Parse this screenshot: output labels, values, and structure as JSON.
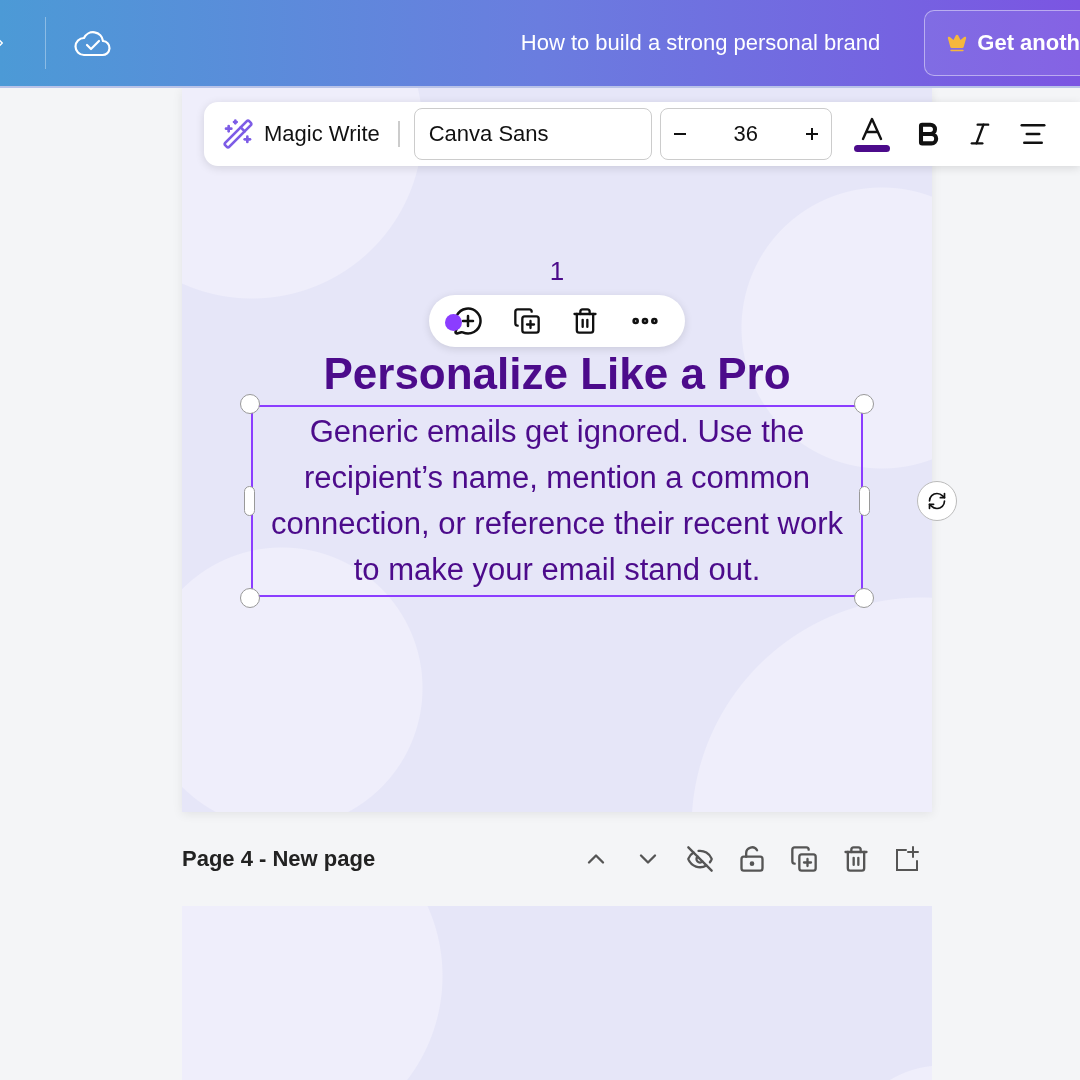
{
  "header": {
    "title": "How to build a strong personal brand",
    "upgrade_button": "Get anoth"
  },
  "text_toolbar": {
    "magic_write": "Magic Write",
    "font": "Canva Sans",
    "font_size": "36"
  },
  "page": {
    "number": "1",
    "heading": "Personalize Like a Pro",
    "body": "Generic emails get ignored. Use the recipient’s name, mention a common connection, or reference their recent work to make your email stand out.",
    "body_selected": true
  },
  "next_page": {
    "label": "Page 4 - New page"
  }
}
